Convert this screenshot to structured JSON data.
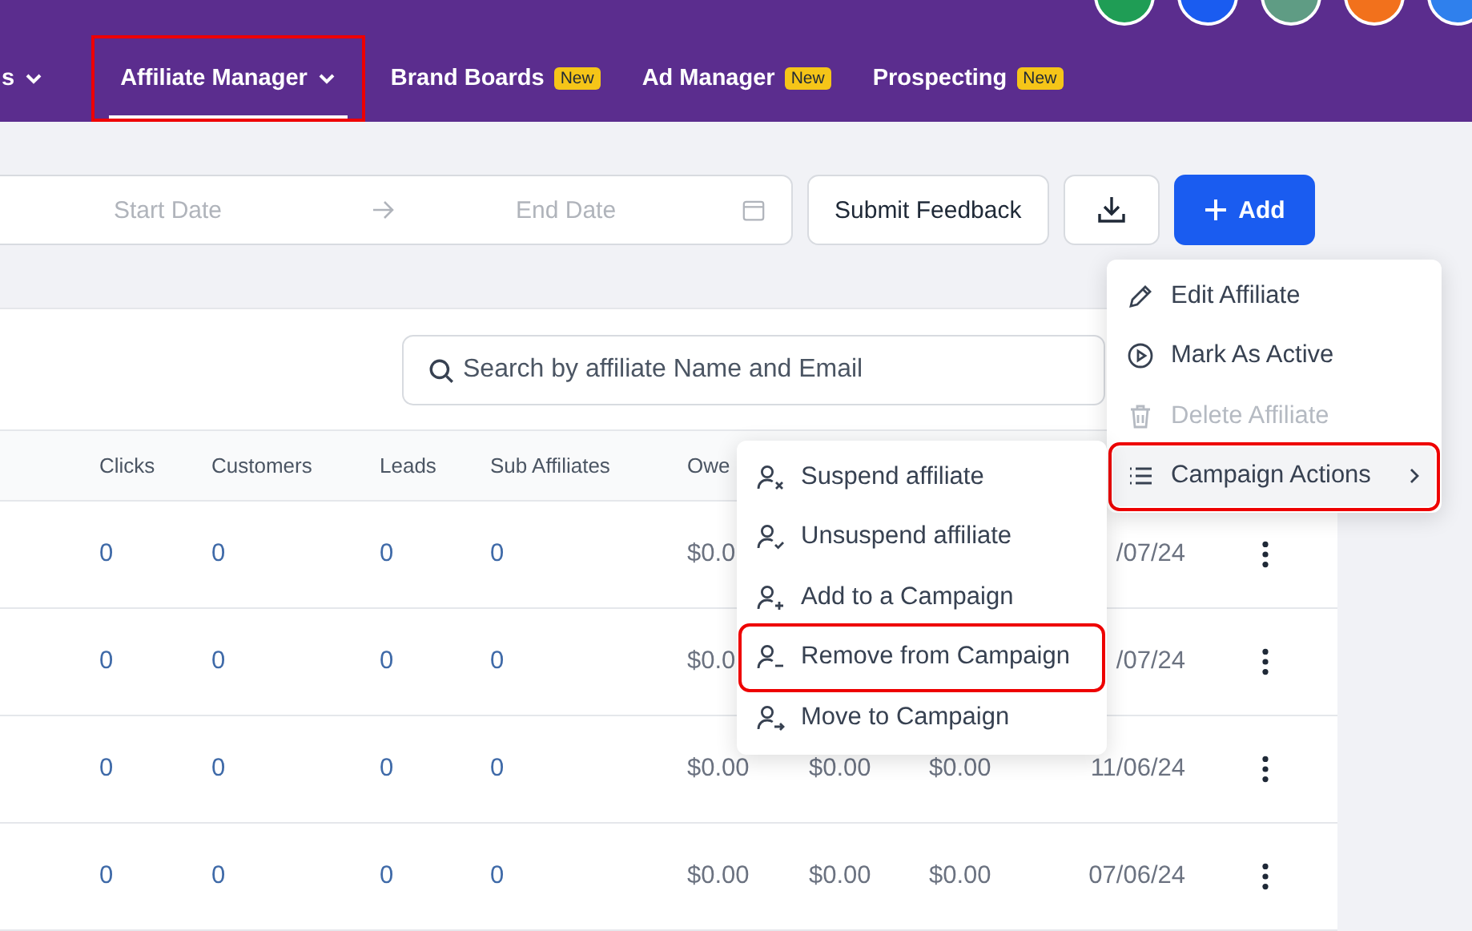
{
  "nav": {
    "items": [
      {
        "label": "s",
        "selected": false,
        "dropdown": true,
        "highlighted": false
      },
      {
        "label": "Affiliate Manager",
        "selected": true,
        "dropdown": true,
        "highlighted": true
      },
      {
        "label": "Brand Boards",
        "badge": "New",
        "selected": false,
        "dropdown": false,
        "highlighted": false
      },
      {
        "label": "Ad Manager",
        "badge": "New",
        "selected": false,
        "dropdown": false,
        "highlighted": false
      },
      {
        "label": "Prospecting",
        "badge": "New",
        "selected": false,
        "dropdown": false,
        "highlighted": false
      }
    ]
  },
  "toolbar": {
    "date_range": {
      "start_placeholder": "Start Date",
      "end_placeholder": "End Date"
    },
    "feedback_button": "Submit Feedback",
    "add_button": "Add"
  },
  "search": {
    "placeholder": "Search by affiliate Name and Email"
  },
  "table": {
    "columns": [
      "Clicks",
      "Customers",
      "Leads",
      "Sub Affiliates",
      "Owe"
    ],
    "rows": [
      {
        "cells": [
          "0",
          "0",
          "0",
          "0",
          "$0.0"
        ],
        "date": "/07/24"
      },
      {
        "cells": [
          "0",
          "0",
          "0",
          "0",
          "$0.0"
        ],
        "date": "/07/24"
      },
      {
        "cells": [
          "0",
          "0",
          "0",
          "0",
          "$0.00",
          "$0.00",
          "$0.00"
        ],
        "date": "11/06/24"
      },
      {
        "cells": [
          "0",
          "0",
          "0",
          "0",
          "$0.00",
          "$0.00",
          "$0.00"
        ],
        "date": "07/06/24"
      }
    ]
  },
  "action_menu": {
    "items": [
      {
        "label": "Edit Affiliate",
        "disabled": false,
        "selected": false,
        "submenu": false,
        "highlighted": false
      },
      {
        "label": "Mark As Active",
        "disabled": false,
        "selected": false,
        "submenu": false,
        "highlighted": false
      },
      {
        "label": "Delete Affiliate",
        "disabled": true,
        "selected": false,
        "submenu": false,
        "highlighted": false
      },
      {
        "label": "Campaign Actions",
        "disabled": false,
        "selected": true,
        "submenu": true,
        "highlighted": true
      }
    ]
  },
  "campaign_menu": {
    "items": [
      {
        "label": "Suspend affiliate",
        "highlighted": false
      },
      {
        "label": "Unsuspend affiliate",
        "highlighted": false
      },
      {
        "label": "Add to a Campaign",
        "highlighted": false
      },
      {
        "label": "Remove from Campaign",
        "highlighted": true
      },
      {
        "label": "Move to Campaign",
        "highlighted": false
      }
    ]
  }
}
